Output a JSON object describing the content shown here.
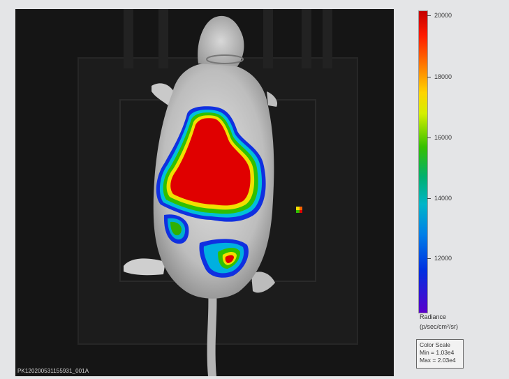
{
  "image": {
    "id_label": "PK120200531155931_001A"
  },
  "colorbar": {
    "ticks": [
      "20000",
      "18000",
      "16000",
      "14000",
      "12000"
    ],
    "unit_label": "Radiance",
    "unit_sub": "(p/sec/cm²/sr)"
  },
  "color_scale": {
    "title": "Color Scale",
    "min": "Min = 1.03e4",
    "max": "Max = 2.03e4"
  },
  "colors": {
    "signal_red": "#e00000",
    "signal_yellow": "#f0e000",
    "signal_green": "#30c000",
    "signal_blue": "#1030e0",
    "background": "#e4e5e7"
  }
}
